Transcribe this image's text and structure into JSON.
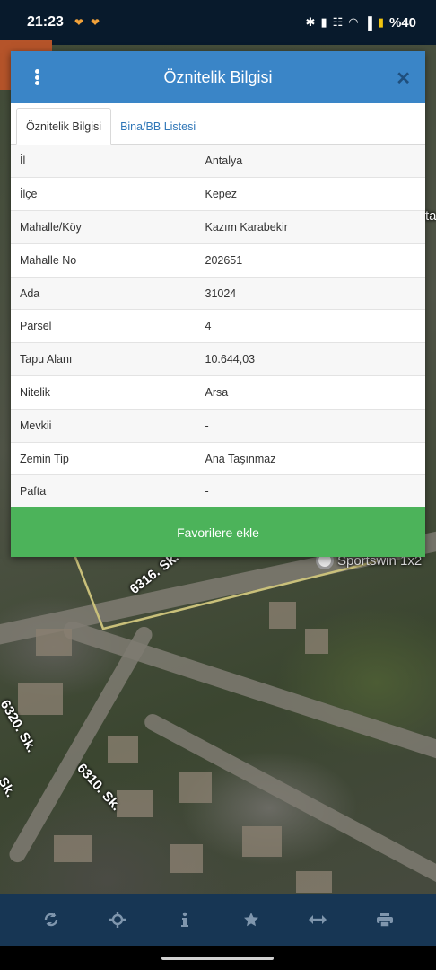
{
  "status_bar": {
    "time": "21:23",
    "battery": "%40"
  },
  "map": {
    "labels": [
      "6316. Sk.",
      "6310. Sk.",
      "6320. Sk.",
      "Sportswin 1x2",
      "Sk.",
      "ta"
    ]
  },
  "dialog": {
    "title": "Öznitelik Bilgisi",
    "tabs": [
      {
        "label": "Öznitelik Bilgisi",
        "active": true
      },
      {
        "label": "Bina/BB Listesi",
        "active": false
      }
    ],
    "rows": [
      {
        "key": "İl",
        "value": "Antalya"
      },
      {
        "key": "İlçe",
        "value": "Kepez"
      },
      {
        "key": "Mahalle/Köy",
        "value": "Kazım Karabekir"
      },
      {
        "key": "Mahalle No",
        "value": "202651"
      },
      {
        "key": "Ada",
        "value": "31024"
      },
      {
        "key": "Parsel",
        "value": "4"
      },
      {
        "key": "Tapu Alanı",
        "value": "10.644,03"
      },
      {
        "key": "Nitelik",
        "value": "Arsa"
      },
      {
        "key": "Mevkii",
        "value": "-"
      },
      {
        "key": "Zemin Tip",
        "value": "Ana Taşınmaz"
      },
      {
        "key": "Pafta",
        "value": "-"
      }
    ],
    "favorite_button": "Favorilere ekle"
  },
  "toolbar": {
    "icons": [
      "refresh-icon",
      "crosshair-icon",
      "info-icon",
      "star-icon",
      "measure-icon",
      "print-icon"
    ],
    "icon_color": "#7f96ad"
  },
  "colors": {
    "header": "#3a85c7",
    "favorite_button": "#4cb35a",
    "toolbar": "#173654"
  }
}
